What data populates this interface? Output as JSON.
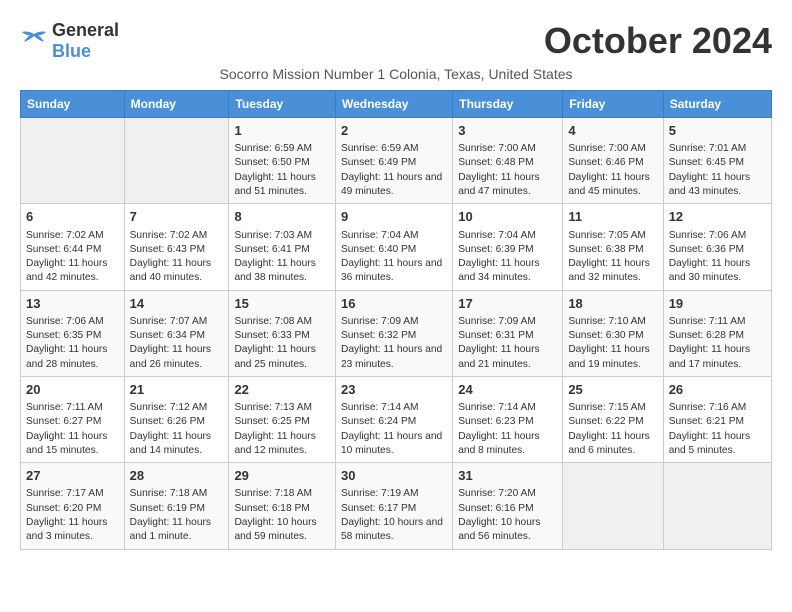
{
  "logo": {
    "general": "General",
    "blue": "Blue"
  },
  "title": "October 2024",
  "subtitle": "Socorro Mission Number 1 Colonia, Texas, United States",
  "days_of_week": [
    "Sunday",
    "Monday",
    "Tuesday",
    "Wednesday",
    "Thursday",
    "Friday",
    "Saturday"
  ],
  "weeks": [
    [
      {
        "day": "",
        "info": ""
      },
      {
        "day": "",
        "info": ""
      },
      {
        "day": "1",
        "sunrise": "Sunrise: 6:59 AM",
        "sunset": "Sunset: 6:50 PM",
        "daylight": "Daylight: 11 hours and 51 minutes."
      },
      {
        "day": "2",
        "sunrise": "Sunrise: 6:59 AM",
        "sunset": "Sunset: 6:49 PM",
        "daylight": "Daylight: 11 hours and 49 minutes."
      },
      {
        "day": "3",
        "sunrise": "Sunrise: 7:00 AM",
        "sunset": "Sunset: 6:48 PM",
        "daylight": "Daylight: 11 hours and 47 minutes."
      },
      {
        "day": "4",
        "sunrise": "Sunrise: 7:00 AM",
        "sunset": "Sunset: 6:46 PM",
        "daylight": "Daylight: 11 hours and 45 minutes."
      },
      {
        "day": "5",
        "sunrise": "Sunrise: 7:01 AM",
        "sunset": "Sunset: 6:45 PM",
        "daylight": "Daylight: 11 hours and 43 minutes."
      }
    ],
    [
      {
        "day": "6",
        "sunrise": "Sunrise: 7:02 AM",
        "sunset": "Sunset: 6:44 PM",
        "daylight": "Daylight: 11 hours and 42 minutes."
      },
      {
        "day": "7",
        "sunrise": "Sunrise: 7:02 AM",
        "sunset": "Sunset: 6:43 PM",
        "daylight": "Daylight: 11 hours and 40 minutes."
      },
      {
        "day": "8",
        "sunrise": "Sunrise: 7:03 AM",
        "sunset": "Sunset: 6:41 PM",
        "daylight": "Daylight: 11 hours and 38 minutes."
      },
      {
        "day": "9",
        "sunrise": "Sunrise: 7:04 AM",
        "sunset": "Sunset: 6:40 PM",
        "daylight": "Daylight: 11 hours and 36 minutes."
      },
      {
        "day": "10",
        "sunrise": "Sunrise: 7:04 AM",
        "sunset": "Sunset: 6:39 PM",
        "daylight": "Daylight: 11 hours and 34 minutes."
      },
      {
        "day": "11",
        "sunrise": "Sunrise: 7:05 AM",
        "sunset": "Sunset: 6:38 PM",
        "daylight": "Daylight: 11 hours and 32 minutes."
      },
      {
        "day": "12",
        "sunrise": "Sunrise: 7:06 AM",
        "sunset": "Sunset: 6:36 PM",
        "daylight": "Daylight: 11 hours and 30 minutes."
      }
    ],
    [
      {
        "day": "13",
        "sunrise": "Sunrise: 7:06 AM",
        "sunset": "Sunset: 6:35 PM",
        "daylight": "Daylight: 11 hours and 28 minutes."
      },
      {
        "day": "14",
        "sunrise": "Sunrise: 7:07 AM",
        "sunset": "Sunset: 6:34 PM",
        "daylight": "Daylight: 11 hours and 26 minutes."
      },
      {
        "day": "15",
        "sunrise": "Sunrise: 7:08 AM",
        "sunset": "Sunset: 6:33 PM",
        "daylight": "Daylight: 11 hours and 25 minutes."
      },
      {
        "day": "16",
        "sunrise": "Sunrise: 7:09 AM",
        "sunset": "Sunset: 6:32 PM",
        "daylight": "Daylight: 11 hours and 23 minutes."
      },
      {
        "day": "17",
        "sunrise": "Sunrise: 7:09 AM",
        "sunset": "Sunset: 6:31 PM",
        "daylight": "Daylight: 11 hours and 21 minutes."
      },
      {
        "day": "18",
        "sunrise": "Sunrise: 7:10 AM",
        "sunset": "Sunset: 6:30 PM",
        "daylight": "Daylight: 11 hours and 19 minutes."
      },
      {
        "day": "19",
        "sunrise": "Sunrise: 7:11 AM",
        "sunset": "Sunset: 6:28 PM",
        "daylight": "Daylight: 11 hours and 17 minutes."
      }
    ],
    [
      {
        "day": "20",
        "sunrise": "Sunrise: 7:11 AM",
        "sunset": "Sunset: 6:27 PM",
        "daylight": "Daylight: 11 hours and 15 minutes."
      },
      {
        "day": "21",
        "sunrise": "Sunrise: 7:12 AM",
        "sunset": "Sunset: 6:26 PM",
        "daylight": "Daylight: 11 hours and 14 minutes."
      },
      {
        "day": "22",
        "sunrise": "Sunrise: 7:13 AM",
        "sunset": "Sunset: 6:25 PM",
        "daylight": "Daylight: 11 hours and 12 minutes."
      },
      {
        "day": "23",
        "sunrise": "Sunrise: 7:14 AM",
        "sunset": "Sunset: 6:24 PM",
        "daylight": "Daylight: 11 hours and 10 minutes."
      },
      {
        "day": "24",
        "sunrise": "Sunrise: 7:14 AM",
        "sunset": "Sunset: 6:23 PM",
        "daylight": "Daylight: 11 hours and 8 minutes."
      },
      {
        "day": "25",
        "sunrise": "Sunrise: 7:15 AM",
        "sunset": "Sunset: 6:22 PM",
        "daylight": "Daylight: 11 hours and 6 minutes."
      },
      {
        "day": "26",
        "sunrise": "Sunrise: 7:16 AM",
        "sunset": "Sunset: 6:21 PM",
        "daylight": "Daylight: 11 hours and 5 minutes."
      }
    ],
    [
      {
        "day": "27",
        "sunrise": "Sunrise: 7:17 AM",
        "sunset": "Sunset: 6:20 PM",
        "daylight": "Daylight: 11 hours and 3 minutes."
      },
      {
        "day": "28",
        "sunrise": "Sunrise: 7:18 AM",
        "sunset": "Sunset: 6:19 PM",
        "daylight": "Daylight: 11 hours and 1 minute."
      },
      {
        "day": "29",
        "sunrise": "Sunrise: 7:18 AM",
        "sunset": "Sunset: 6:18 PM",
        "daylight": "Daylight: 10 hours and 59 minutes."
      },
      {
        "day": "30",
        "sunrise": "Sunrise: 7:19 AM",
        "sunset": "Sunset: 6:17 PM",
        "daylight": "Daylight: 10 hours and 58 minutes."
      },
      {
        "day": "31",
        "sunrise": "Sunrise: 7:20 AM",
        "sunset": "Sunset: 6:16 PM",
        "daylight": "Daylight: 10 hours and 56 minutes."
      },
      {
        "day": "",
        "info": ""
      },
      {
        "day": "",
        "info": ""
      }
    ]
  ]
}
